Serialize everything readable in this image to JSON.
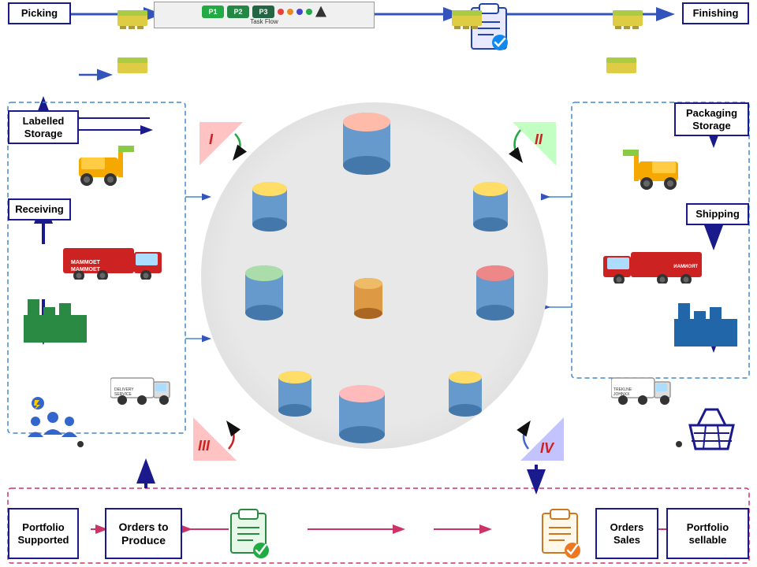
{
  "labels": {
    "picking": "Picking",
    "finishing": "Finishing",
    "labelled_storage": "Labelled Storage",
    "packaging_storage": "Packaging Storage",
    "receiving": "Receiving",
    "shipping": "Shipping",
    "portfolio_supported": "Portfolio Supported",
    "orders_to_produce": "Orders to Produce",
    "orders_sales": "Orders Sales",
    "portfolio_sellable": "Portfolio sellable"
  },
  "roman": {
    "I": "I",
    "II": "II",
    "III": "III",
    "IV": "IV"
  },
  "top_label": "Task Flow",
  "colors": {
    "accent_blue": "#1a1a8c",
    "arrow_blue": "#3355bb",
    "dashed_blue": "#4488cc",
    "dashed_pink": "#cc3366",
    "circle_bg": "#e0e0e8",
    "cyl_blue": "#6699cc",
    "cyl_yellow": "#ddcc44",
    "cyl_pink": "#ee9999",
    "cyl_green": "#88cc88",
    "cyl_orange": "#ee9944",
    "cyl_center": "#cc8844"
  }
}
